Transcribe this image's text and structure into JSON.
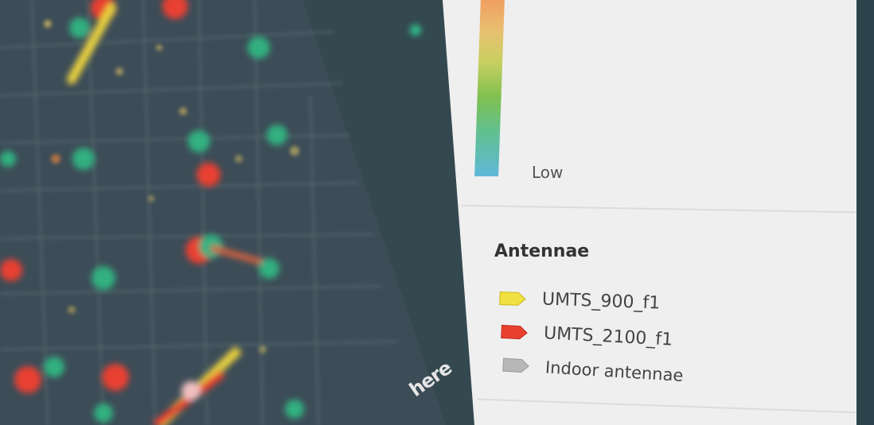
{
  "map": {
    "logo_text": "here"
  },
  "legend": {
    "gradient": {
      "low_label": "Low",
      "colors": [
        "#f0a060",
        "#e8c070",
        "#c8d060",
        "#80c050",
        "#60c090",
        "#60b8d8"
      ]
    },
    "antennae": {
      "title": "Antennae",
      "items": [
        {
          "label": "UMTS_900_f1",
          "color": "#f0e040",
          "icon": "yellow-antenna-icon"
        },
        {
          "label": "UMTS_2100_f1",
          "color": "#e84030",
          "icon": "red-antenna-icon"
        },
        {
          "label": "Indoor antennae",
          "color": "#b8b8b8",
          "icon": "gray-antenna-icon"
        }
      ]
    }
  }
}
